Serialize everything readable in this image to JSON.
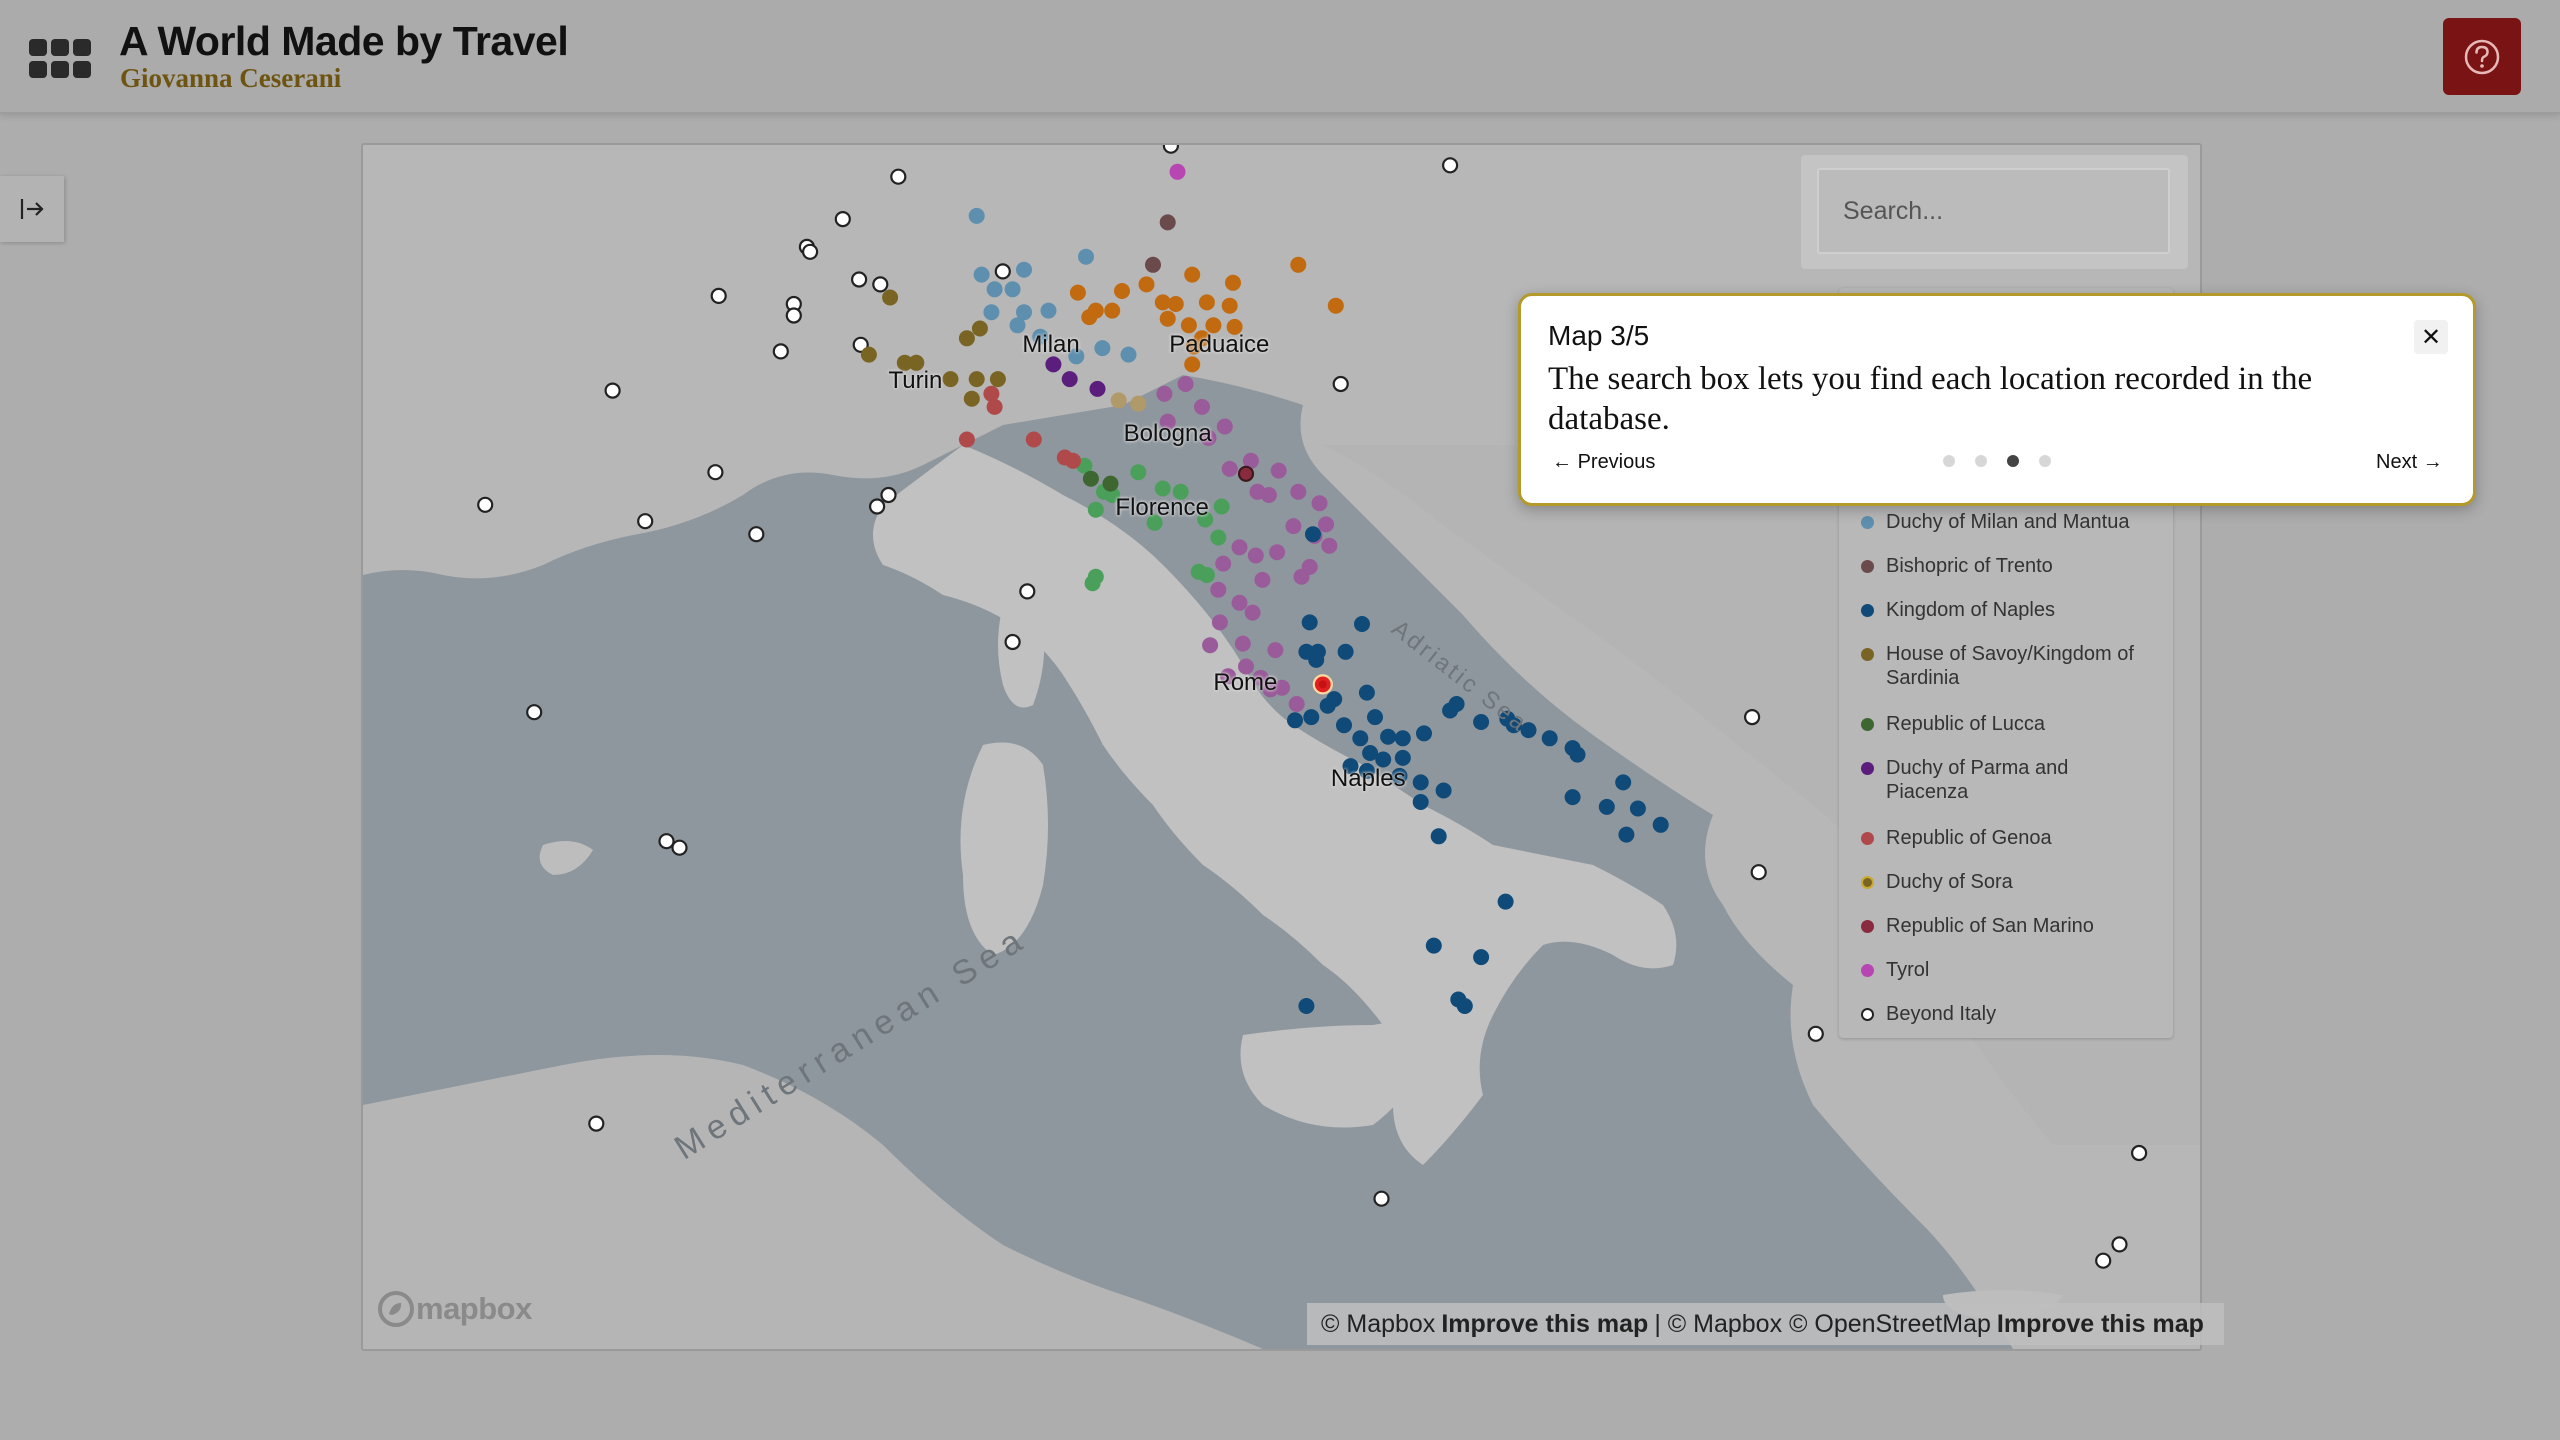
{
  "header": {
    "title": "A World Made by Travel",
    "author": "Giovanna Ceserani",
    "apps_icon": "grid-apps-icon",
    "help_icon": "question-circle-icon",
    "accent_color": "#7a1314"
  },
  "sidebar": {
    "toggle_icon": "expand-sidebar-icon"
  },
  "search": {
    "placeholder": "Search..."
  },
  "map": {
    "city_labels": [
      "Milan",
      "Turin",
      "Paduaice",
      "Bologna",
      "Florence",
      "Rome",
      "Naples"
    ],
    "sea_labels": [
      "Adriatic Sea",
      "Mediterranean Sea",
      "Mediterranean"
    ]
  },
  "legend": {
    "items": [
      {
        "label": "Duchy of Milan and Mantua",
        "color": "#5e8fae"
      },
      {
        "label": "Bishopric of Trento",
        "color": "#6b4a4c"
      },
      {
        "label": "Kingdom of Naples",
        "color": "#0f4a78"
      },
      {
        "label": "House of Savoy/Kingdom of Sardinia",
        "color": "#7a6423"
      },
      {
        "label": "Republic of Lucca",
        "color": "#3d6630"
      },
      {
        "label": "Duchy of Parma and Piacenza",
        "color": "#5b1e7c"
      },
      {
        "label": "Republic of Genoa",
        "color": "#b04a4a"
      },
      {
        "label": "Duchy of Sora",
        "color": "#7a6423"
      },
      {
        "label": "Republic of San Marino",
        "color": "#8a2a3e"
      },
      {
        "label": "Tyrol",
        "color": "#b746b3"
      },
      {
        "label": "Beyond Italy",
        "color": "#ffffff"
      }
    ]
  },
  "attribution": {
    "copyright1": "© Mapbox",
    "improve1": "Improve this map",
    "separator": "|",
    "copyright2": "© Mapbox",
    "copyright3": "© OpenStreetMap",
    "improve2": "Improve this map",
    "logo": "mapbox"
  },
  "tour": {
    "step": "Map 3/5",
    "text": "The search box lets you find each location recorded in the database.",
    "previous": "Previous",
    "next": "Next",
    "total_steps": 5,
    "active_step": 3
  }
}
